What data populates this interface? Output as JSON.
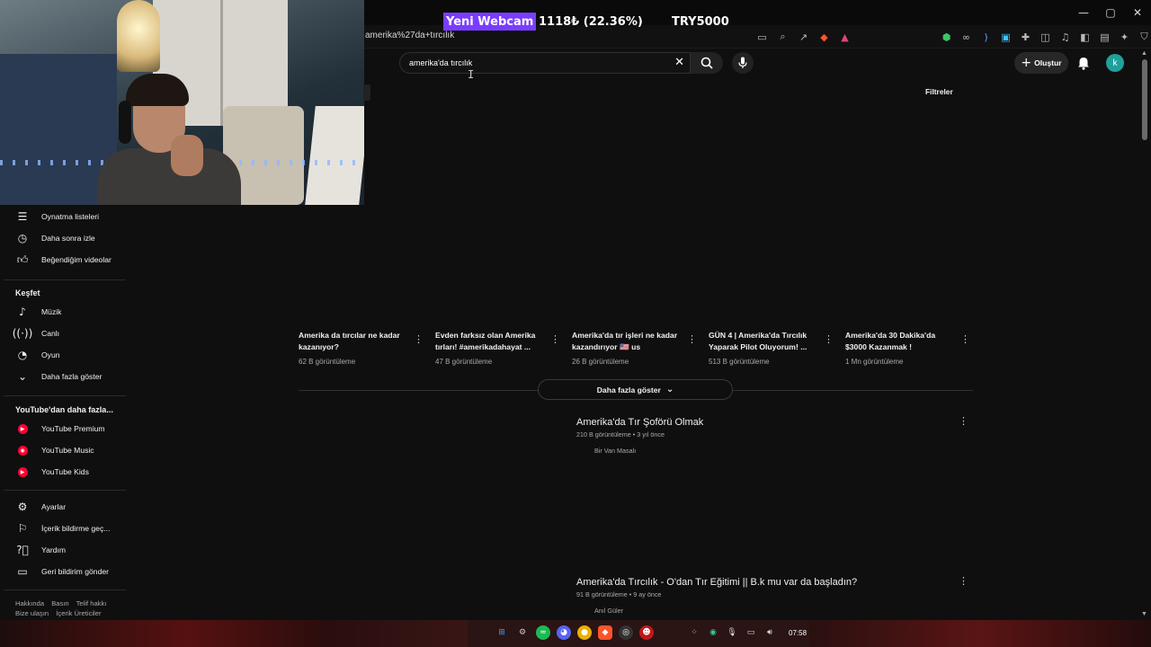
{
  "overlay": {
    "webcam_label": "Yeni Webcam",
    "price": "1118₺ (22.36%)",
    "target": "TRY5000"
  },
  "browser": {
    "url": "amerika%27da+tırcılık",
    "window_controls": [
      "—",
      "▢",
      "✕"
    ]
  },
  "search": {
    "value": "amerika'da tırcılık"
  },
  "header": {
    "create_label": "Oluştur",
    "avatar_letter": "k",
    "filters_label": "Filtreler"
  },
  "sidebar": {
    "items_you": [
      {
        "icon": "playlist-icon",
        "label": "Oynatma listeleri"
      },
      {
        "icon": "watch-later-icon",
        "label": "Daha sonra izle"
      },
      {
        "icon": "thumbs-up-icon",
        "label": "Beğendiğim videolar"
      }
    ],
    "explore_heading": "Keşfet",
    "items_explore": [
      {
        "icon": "music-note-icon",
        "label": "Müzik"
      },
      {
        "icon": "live-icon",
        "label": "Canlı"
      },
      {
        "icon": "gaming-icon",
        "label": "Oyun"
      },
      {
        "icon": "chevron-down-icon",
        "label": "Daha fazla göster"
      }
    ],
    "more_heading": "YouTube'dan daha fazla...",
    "items_more": [
      {
        "icon": "youtube-premium-icon",
        "label": "YouTube Premium"
      },
      {
        "icon": "youtube-music-icon",
        "label": "YouTube Music"
      },
      {
        "icon": "youtube-kids-icon",
        "label": "YouTube Kids"
      }
    ],
    "items_settings": [
      {
        "icon": "gear-icon",
        "label": "Ayarlar"
      },
      {
        "icon": "flag-icon",
        "label": "İçerik bildirme geç..."
      },
      {
        "icon": "help-icon",
        "label": "Yardım"
      },
      {
        "icon": "feedback-icon",
        "label": "Geri bildirim gönder"
      }
    ],
    "footer_line1": [
      "Hakkında",
      "Basın",
      "Telif hakkı"
    ],
    "footer_line2": [
      "Bize ulaşın",
      "İçerik Üreticiler"
    ]
  },
  "shorts": [
    {
      "title": "Amerika da tırcılar ne kadar kazanıyor?",
      "views": "62 B görüntüleme"
    },
    {
      "title": "Evden farksız olan Amerika tırları! #amerikadahayat ...",
      "views": "47 B görüntüleme"
    },
    {
      "title": "Amerika'da tır işleri ne kadar kazandırıyor 🇺🇸 us",
      "views": "26 B görüntüleme"
    },
    {
      "title": "GÜN 4 | Amerika'da Tırcılık Yaparak Pilot Oluyorum! ...",
      "views": "513 B görüntüleme"
    },
    {
      "title": "Amerika'da 30 Dakika'da $3000 Kazanmak !",
      "views": "1 Mn görüntüleme"
    }
  ],
  "show_more_label": "Daha fazla göster",
  "videos": [
    {
      "title": "Amerika'da Tır Şoförü Olmak",
      "meta": "210 B görüntüleme • 3 yıl önce",
      "channel": "Bir Van Masalı"
    },
    {
      "title": "Amerika'da Tırcılık - O'dan Tır Eğitimi || B.k mu var da başladın?",
      "meta": "91 B görüntüleme • 9 ay önce",
      "channel": "Anıl Güler"
    }
  ],
  "taskbar": {
    "clock": "07:58"
  }
}
